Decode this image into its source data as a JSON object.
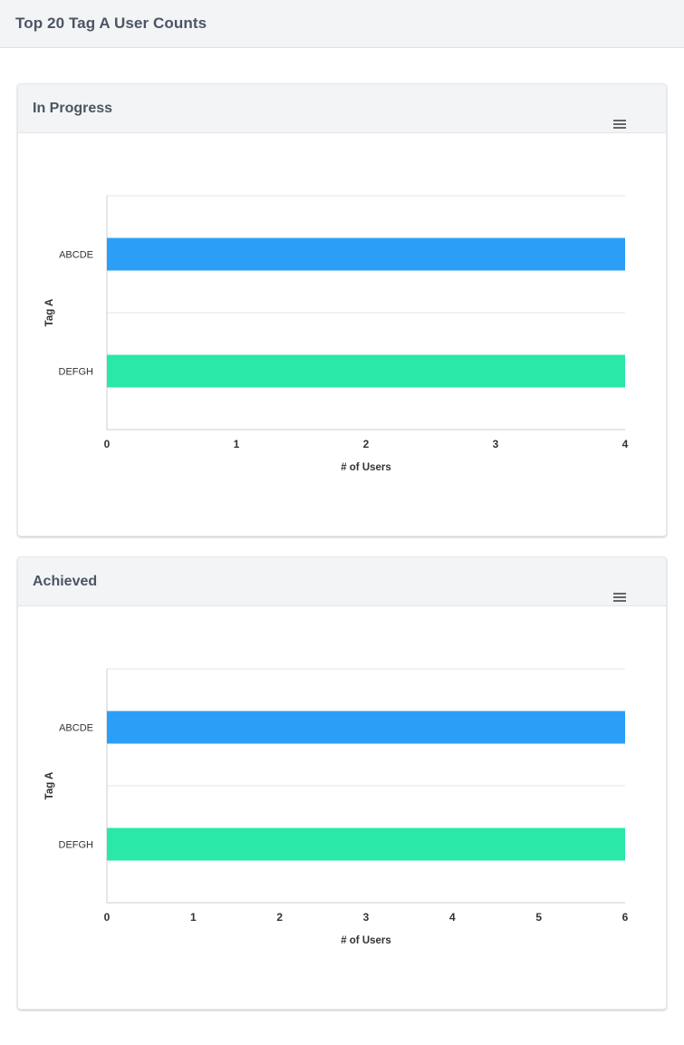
{
  "page": {
    "title": "Top 20 Tag A User Counts"
  },
  "colors": {
    "series_1": "#2b9ff7",
    "series_2": "#29e8a8",
    "grid": "#e6e6e6",
    "axis": "#cccccc"
  },
  "icons": {
    "card_menu": "hamburger-menu-icon"
  },
  "cards": [
    {
      "title": "In Progress",
      "chart_data": {
        "type": "bar",
        "orientation": "horizontal",
        "categories": [
          "ABCDE",
          "DEFGH"
        ],
        "values": [
          4,
          4
        ],
        "colors": [
          "#2b9ff7",
          "#29e8a8"
        ],
        "xlabel": "# of Users",
        "ylabel": "Tag A",
        "xlim": [
          0,
          4
        ],
        "xticks": [
          0,
          1,
          2,
          3,
          4
        ],
        "grid": true,
        "legend": "none"
      }
    },
    {
      "title": "Achieved",
      "chart_data": {
        "type": "bar",
        "orientation": "horizontal",
        "categories": [
          "ABCDE",
          "DEFGH"
        ],
        "values": [
          6,
          6
        ],
        "colors": [
          "#2b9ff7",
          "#29e8a8"
        ],
        "xlabel": "# of Users",
        "ylabel": "Tag A",
        "xlim": [
          0,
          6
        ],
        "xticks": [
          0,
          1,
          2,
          3,
          4,
          5,
          6
        ],
        "grid": true,
        "legend": "none"
      }
    }
  ]
}
